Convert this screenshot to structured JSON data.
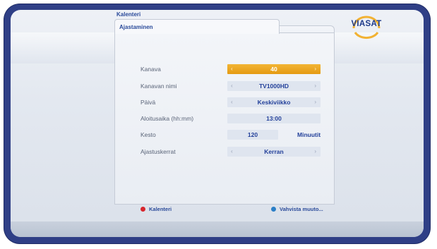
{
  "header": {
    "breadcrumb": "Kalenteri",
    "tab_label": "Ajastaminen",
    "logo_text": "VIASAT"
  },
  "form": {
    "rows": [
      {
        "label": "Kanava",
        "value": "40",
        "has_arrows": true,
        "selected": true
      },
      {
        "label": "Kanavan nimi",
        "value": "TV1000HD",
        "has_arrows": true,
        "selected": false
      },
      {
        "label": "Päivä",
        "value": "Keskiviikko",
        "has_arrows": true,
        "selected": false
      },
      {
        "label": "Aloitusaika (hh:mm)",
        "value": "13:00",
        "has_arrows": false,
        "selected": false
      },
      {
        "label": "Kesto",
        "value": "120",
        "unit": "Minuutit",
        "has_arrows": false,
        "selected": false
      },
      {
        "label": "Ajastuskerrat",
        "value": "Kerran",
        "has_arrows": true,
        "selected": false
      }
    ],
    "arrow_left": "‹",
    "arrow_right": "›"
  },
  "footer": {
    "red_button_label": "Kalenteri",
    "blue_button_label": "Vahvista muuto..."
  },
  "colors": {
    "frame": "#2f3f86",
    "accent_selected": "#e8a01a",
    "text_blue": "#23409a",
    "red_button": "#d7262e",
    "blue_button": "#2b7fc7",
    "logo_ring": "#f2b233"
  }
}
